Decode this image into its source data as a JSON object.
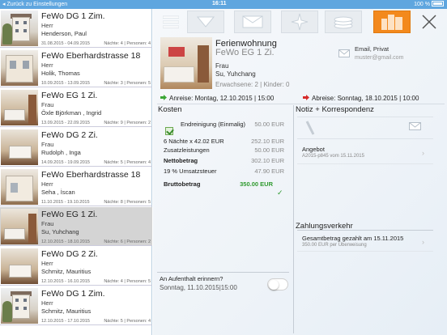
{
  "status_bar": {
    "back_label": "Zurück zu Einstellungen",
    "time": "16:11",
    "battery": "100 %"
  },
  "list": [
    {
      "title": "FeWo DG 1 Zim.",
      "salutation": "Herr",
      "name": "Henderson, Paul",
      "dates": "31.08.2015 - 04.09.2015",
      "counts": "Nächte: 4 | Personen: 4"
    },
    {
      "title": "FeWo Eberhardstrasse 18",
      "salutation": "Herr",
      "name": "Holik, Thomas",
      "dates": "10.09.2015 - 13.09.2015",
      "counts": "Nächte: 3 | Personen: 5"
    },
    {
      "title": "FeWo EG 1 Zi.",
      "salutation": "Frau",
      "name": "Öxle Björkman , Ingrid",
      "dates": "13.09.2015 - 22.09.2015",
      "counts": "Nächte: 9 | Personen: 2"
    },
    {
      "title": "FeWo DG 2 Zi.",
      "salutation": "Frau",
      "name": "Rudolph , Inga",
      "dates": "14.09.2015 - 19.09.2015",
      "counts": "Nächte: 5 | Personen: 4"
    },
    {
      "title": "FeWo Eberhardstrasse 18",
      "salutation": "Herr",
      "name": "Seha ,  İscan",
      "dates": "11.10.2015 - 19.10.2015",
      "counts": "Nächte: 8 | Personen: 5"
    },
    {
      "title": "FeWo EG 1 Zi.",
      "salutation": "Frau",
      "name": "Su, Yuhchang",
      "dates": "12.10.2015 - 18.10.2015",
      "counts": "Nächte: 6 | Personen: 2"
    },
    {
      "title": "FeWo DG 2 Zi.",
      "salutation": "Herr",
      "name": "Schmitz, Mauritius",
      "dates": "12.10.2015 - 16.10.2015",
      "counts": "Nächte: 4 | Personen: 5"
    },
    {
      "title": "FeWo DG 1 Zim.",
      "salutation": "Herr",
      "name": "Schmitz, Mauritius",
      "dates": "12.10.2015 - 17.10.2015",
      "counts": "Nächte: 5 | Personen: 4"
    }
  ],
  "toolbar": {
    "icons": [
      "menu-icon",
      "down-arrow-icon",
      "envelope-icon",
      "star-icon",
      "coins-icon",
      "buildings-icon",
      "close-icon"
    ]
  },
  "detail": {
    "title": "Ferienwohnung",
    "unit": "FeWo EG 1 Zi.",
    "salutation": "Frau",
    "name": "Su, Yuhchang",
    "guests": "Erwachsene: 2 | Kinder: 0",
    "email_title": "Email, Privat",
    "email": "muster@gmail.com",
    "arrival": "Anreise: Montag, 12.10.2015 | 15:00",
    "departure": "Abreise: Sonntag, 18.10.2015 | 10:00"
  },
  "costs": {
    "heading": "Kosten",
    "cleaning_label": "Endreinigung (Einmalig)",
    "cleaning_value": "50.00 EUR",
    "nights_label": "6 Nächte x 42.02 EUR",
    "nights_value": "252.10 EUR",
    "extras_label": "Zusatzleistungen",
    "extras_value": "50.00 EUR",
    "net_label": "Nettobetrag",
    "net_value": "302.10 EUR",
    "vat_label": "19 % Umsatzsteuer",
    "vat_value": "47.90 EUR",
    "gross_label": "Bruttobetrag",
    "gross_value": "350.00 EUR"
  },
  "reminder": {
    "question": "An Aufenthalt erinnern?",
    "value": "Sonntag, 11.10.2015|15:00"
  },
  "notes": {
    "heading": "Notiz + Korrespondenz",
    "offer_title": "Angebot",
    "offer_sub": "A2015-p845 vom 15.11.2015"
  },
  "payments": {
    "heading": "Zahlungsverkehr",
    "title": "Gesamtbetrag gezahlt am 15.11.2015",
    "sub": "350.00 EUR per Überweisung"
  },
  "colors": {
    "accent": "#f3891d",
    "statusbar": "#5fa6df",
    "arrival_arrow": "#3aa635",
    "departure_arrow": "#d62b2b",
    "gross": "#2f9a2f"
  }
}
